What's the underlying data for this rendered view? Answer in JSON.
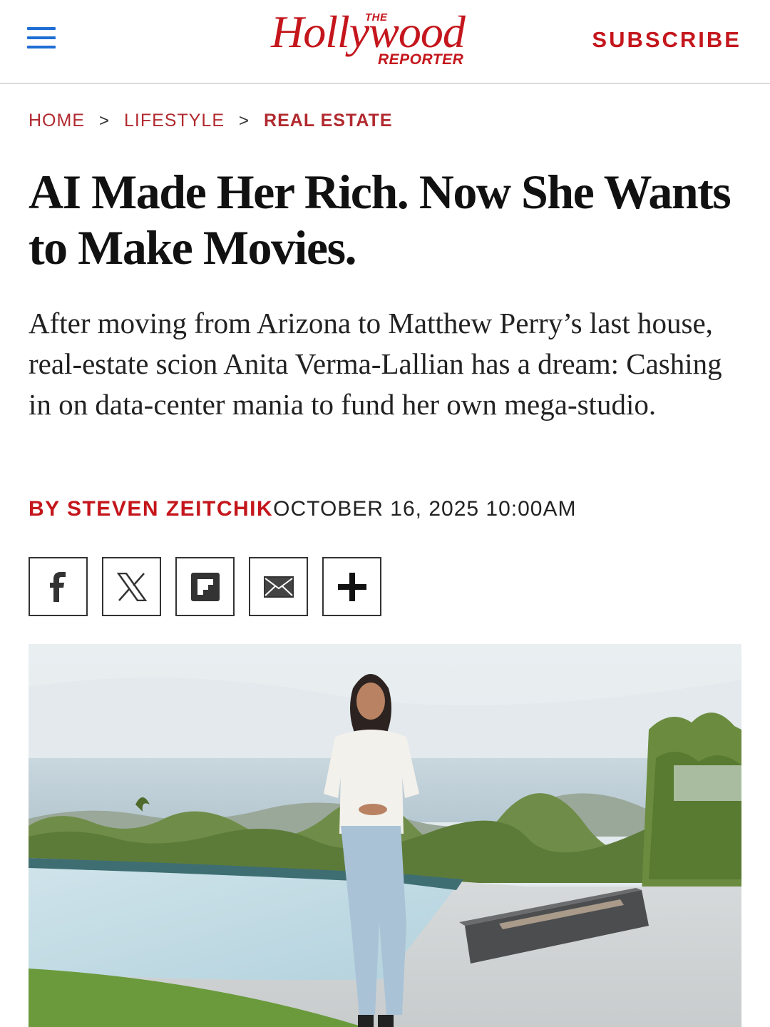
{
  "header": {
    "menu_icon": "hamburger-menu-icon",
    "logo_the": "THE",
    "logo_main": "Hollywood",
    "logo_reporter": "REPORTER",
    "subscribe_label": "SUBSCRIBE",
    "brand_color": "#c4161c",
    "menu_color": "#1f6ed4"
  },
  "breadcrumb": {
    "items": [
      "HOME",
      "LIFESTYLE",
      "REAL ESTATE"
    ],
    "separator": ">"
  },
  "article": {
    "headline": "AI Made Her Rich. Now She Wants to Make Movies.",
    "dek": "After moving from Arizona to Matthew Perry’s last house, real-estate scion Anita Verma-Lallian has a dream: Cashing in on data-center mania to fund her own mega-studio.",
    "byline": "BY STEVEN ZEITCHIK",
    "date": "OCTOBER 16, 2025 10:00AM"
  },
  "share": {
    "buttons": [
      "facebook-icon",
      "x-icon",
      "flipboard-icon",
      "email-icon",
      "plus-icon"
    ]
  },
  "hero_image": {
    "description_icon": "photo"
  }
}
